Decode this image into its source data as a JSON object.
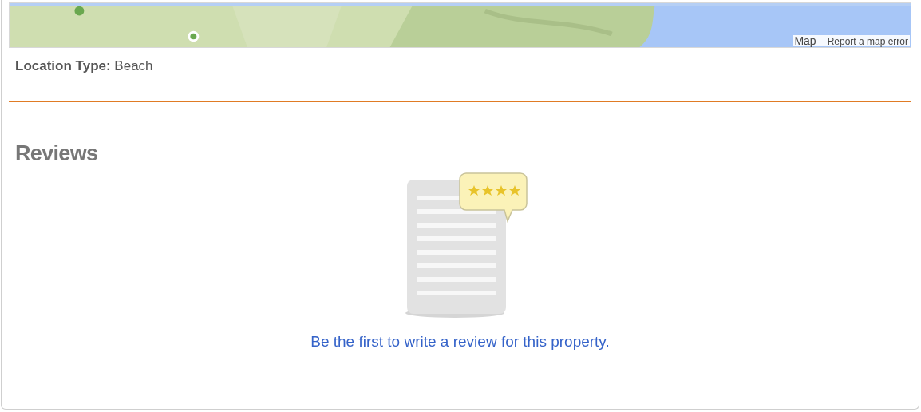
{
  "map": {
    "attribution": "Map",
    "report_link": "Report a map error"
  },
  "location": {
    "label": "Location Type:",
    "value": "Beach"
  },
  "reviews": {
    "heading": "Reviews",
    "cta_link": "Be the first to write a review for this property."
  }
}
